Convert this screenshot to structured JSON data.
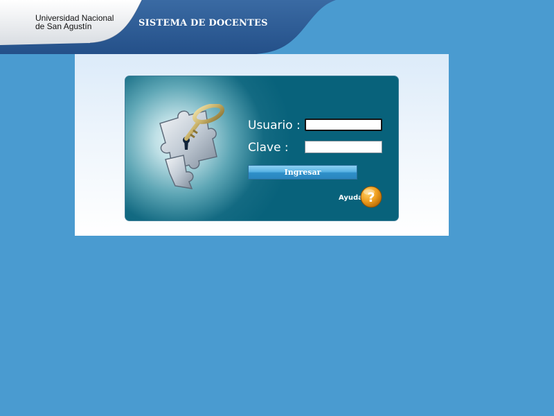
{
  "header": {
    "university_line1": "Universidad Nacional",
    "university_line2": "de San Agustín",
    "system_title": "SISTEMA DE DOCENTES"
  },
  "login": {
    "username_label": "Usuario :",
    "password_label": "Clave :",
    "username_value": "",
    "password_value": "",
    "submit_label": "Ingresar",
    "help_label": "Ayuda",
    "help_icon": "question-mark-icon"
  },
  "colors": {
    "page_background": "#4a9bd0",
    "header_dark_blue": "#2f5f96",
    "login_box_teal": "#08627b",
    "button_blue": "#3a9ad6",
    "help_orange": "#e08a10"
  }
}
